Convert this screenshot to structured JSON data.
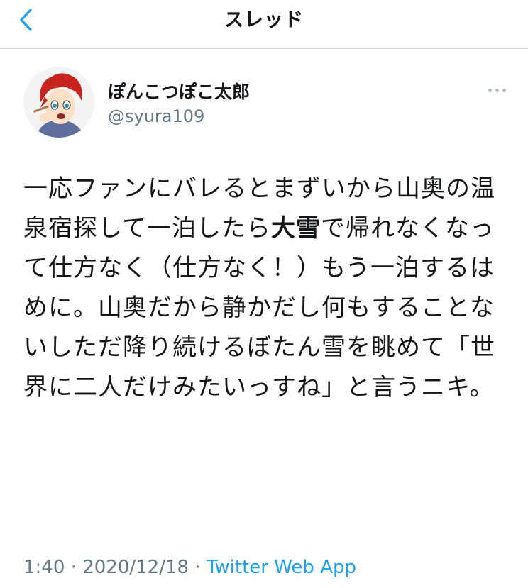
{
  "nav": {
    "title": "スレッド",
    "back_icon": "chevron-left-icon",
    "accent": "#1da1f2"
  },
  "author": {
    "display_name": "ぽんこつぽこ太郎",
    "handle": "@syura109",
    "avatar": "avatar-illustration"
  },
  "tweet": {
    "text_before": "一応ファンにバレるとまずいから山奥の温泉宿探して一泊したら",
    "text_bold": "大雪",
    "text_after": "で帰れなくなって仕方なく（仕方なく！）もう一泊するはめに。山奥だから静かだし何もすることないしただ降り続けるぼたん雪を眺めて「世界に二人だけみたいっすね」と言うニキ。"
  },
  "meta": {
    "time": "1:40",
    "separator1": " · ",
    "date": "2020/12/18",
    "separator2": " · ",
    "source": "Twitter Web App"
  }
}
